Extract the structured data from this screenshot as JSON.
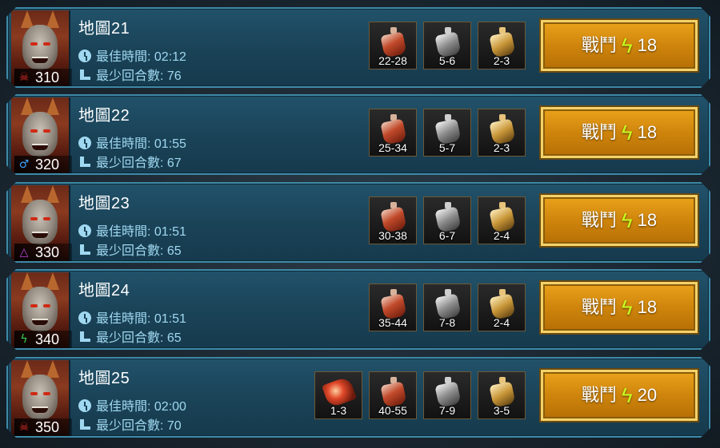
{
  "colors": {
    "panel_border": "#3d8aa8",
    "stat_text": "#9fd8f0",
    "button_gold": "#cf850c",
    "energy_bolt": "#c8ff20"
  },
  "stages": [
    {
      "title": "地圖21",
      "best_time_label": "最佳時間:",
      "best_time": "02:12",
      "min_turns_label": "最少回合數:",
      "min_turns": "76",
      "level": "310",
      "affinity_icon": "skull-icon",
      "affinity_glyph": "☠",
      "affinity_color": "#e0302a",
      "rewards": [
        {
          "icon": "red-potion-icon",
          "range": "22-28"
        },
        {
          "icon": "silver-potion-icon",
          "range": "5-6"
        },
        {
          "icon": "gold-potion-icon",
          "range": "2-3"
        }
      ],
      "battle_label": "戰鬥",
      "energy_cost": "18"
    },
    {
      "title": "地圖22",
      "best_time_label": "最佳時間:",
      "best_time": "01:55",
      "min_turns_label": "最少回合數:",
      "min_turns": "67",
      "level": "320",
      "affinity_icon": "magic-affinity-icon",
      "affinity_glyph": "♂",
      "affinity_color": "#3aa0ff",
      "rewards": [
        {
          "icon": "red-potion-icon",
          "range": "25-34"
        },
        {
          "icon": "silver-potion-icon",
          "range": "5-7"
        },
        {
          "icon": "gold-potion-icon",
          "range": "2-3"
        }
      ],
      "battle_label": "戰鬥",
      "energy_cost": "18"
    },
    {
      "title": "地圖23",
      "best_time_label": "最佳時間:",
      "best_time": "01:51",
      "min_turns_label": "最少回合數:",
      "min_turns": "65",
      "level": "330",
      "affinity_icon": "void-affinity-icon",
      "affinity_glyph": "△",
      "affinity_color": "#c048e0",
      "rewards": [
        {
          "icon": "red-potion-icon",
          "range": "30-38"
        },
        {
          "icon": "silver-potion-icon",
          "range": "6-7"
        },
        {
          "icon": "gold-potion-icon",
          "range": "2-4"
        }
      ],
      "battle_label": "戰鬥",
      "energy_cost": "18"
    },
    {
      "title": "地圖24",
      "best_time_label": "最佳時間:",
      "best_time": "01:51",
      "min_turns_label": "最少回合數:",
      "min_turns": "65",
      "level": "340",
      "affinity_icon": "spirit-affinity-icon",
      "affinity_glyph": "ϟ",
      "affinity_color": "#3ad24a",
      "rewards": [
        {
          "icon": "red-potion-icon",
          "range": "35-44"
        },
        {
          "icon": "silver-potion-icon",
          "range": "7-8"
        },
        {
          "icon": "gold-potion-icon",
          "range": "2-4"
        }
      ],
      "battle_label": "戰鬥",
      "energy_cost": "18"
    },
    {
      "title": "地圖25",
      "best_time_label": "最佳時間:",
      "best_time": "02:00",
      "min_turns_label": "最少回合數:",
      "min_turns": "70",
      "level": "350",
      "affinity_icon": "skull-icon",
      "affinity_glyph": "☠",
      "affinity_color": "#e0302a",
      "rewards": [
        {
          "icon": "fire-shard-icon",
          "range": "1-3"
        },
        {
          "icon": "red-potion-icon",
          "range": "40-55"
        },
        {
          "icon": "silver-potion-icon",
          "range": "7-9"
        },
        {
          "icon": "gold-potion-icon",
          "range": "3-5"
        }
      ],
      "battle_label": "戰鬥",
      "energy_cost": "20"
    }
  ]
}
